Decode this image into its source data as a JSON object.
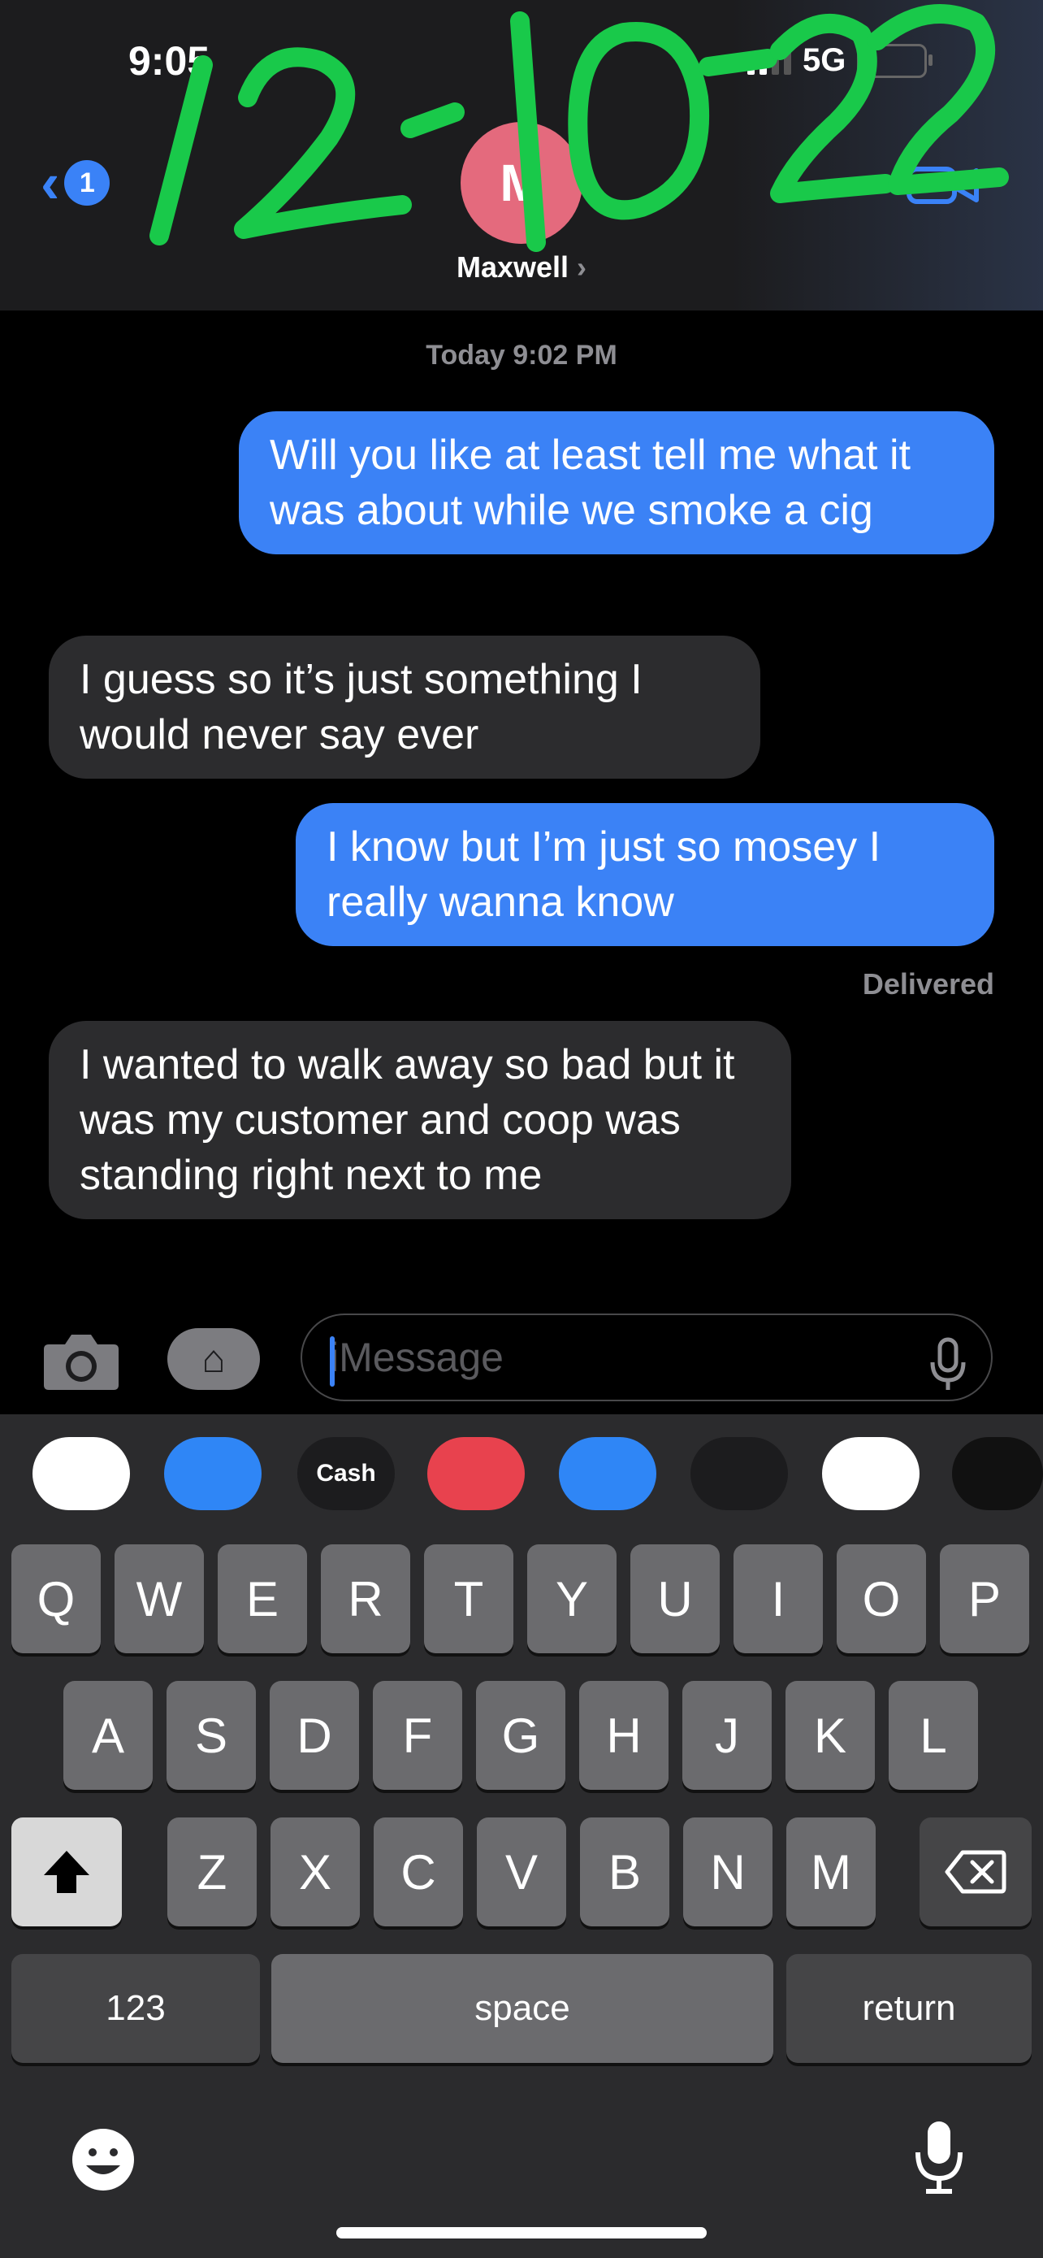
{
  "status_bar": {
    "time": "9:05",
    "network": "5G"
  },
  "header": {
    "back_badge": "1",
    "avatar_initial": "M",
    "contact_name": "Maxwell",
    "contact_chevron": "›"
  },
  "annotation": {
    "handwritten_text": "12-10-22",
    "color": "#19c94a"
  },
  "conversation": {
    "timestamp": "Today 9:02 PM",
    "messages": [
      {
        "direction": "outgoing",
        "text": "Will you like at least tell me what it was about while we smoke a cig"
      },
      {
        "direction": "incoming",
        "text": "I guess so it’s just something I would never say ever"
      },
      {
        "direction": "outgoing",
        "text": "I know but I’m just so mosey I really wanna know"
      },
      {
        "direction": "incoming",
        "text": "I wanted to walk away so bad but it was my customer and coop was standing right next to me"
      }
    ],
    "delivered": "Delivered"
  },
  "composer": {
    "placeholder": "iMessage",
    "camera_icon": "camera-icon",
    "apps_icon": "app-store-icon"
  },
  "app_drawer": [
    {
      "name": "photos-app-icon",
      "bg": "#ffffff"
    },
    {
      "name": "app-store-icon",
      "bg": "#2f86f6"
    },
    {
      "name": "apple-cash-icon",
      "bg": "#1c1c1e",
      "label": "Cash"
    },
    {
      "name": "web-search-icon",
      "bg": "#e8424e"
    },
    {
      "name": "audio-message-icon",
      "bg": "#2f86f6"
    },
    {
      "name": "memoji-icon",
      "bg": "#1c1c1e"
    },
    {
      "name": "memoji-stickers-icon",
      "bg": "#ffffff"
    },
    {
      "name": "digital-touch-icon",
      "bg": "#111111"
    }
  ],
  "keyboard": {
    "row1": [
      "Q",
      "W",
      "E",
      "R",
      "T",
      "Y",
      "U",
      "I",
      "O",
      "P"
    ],
    "row2": [
      "A",
      "S",
      "D",
      "F",
      "G",
      "H",
      "J",
      "K",
      "L"
    ],
    "row3": [
      "Z",
      "X",
      "C",
      "V",
      "B",
      "N",
      "M"
    ],
    "numbers_label": "123",
    "space_label": "space",
    "return_label": "return"
  },
  "colors": {
    "outgoing_bubble": "#3b82f6",
    "incoming_bubble": "#2c2c2e",
    "accent": "#3a82f7"
  }
}
